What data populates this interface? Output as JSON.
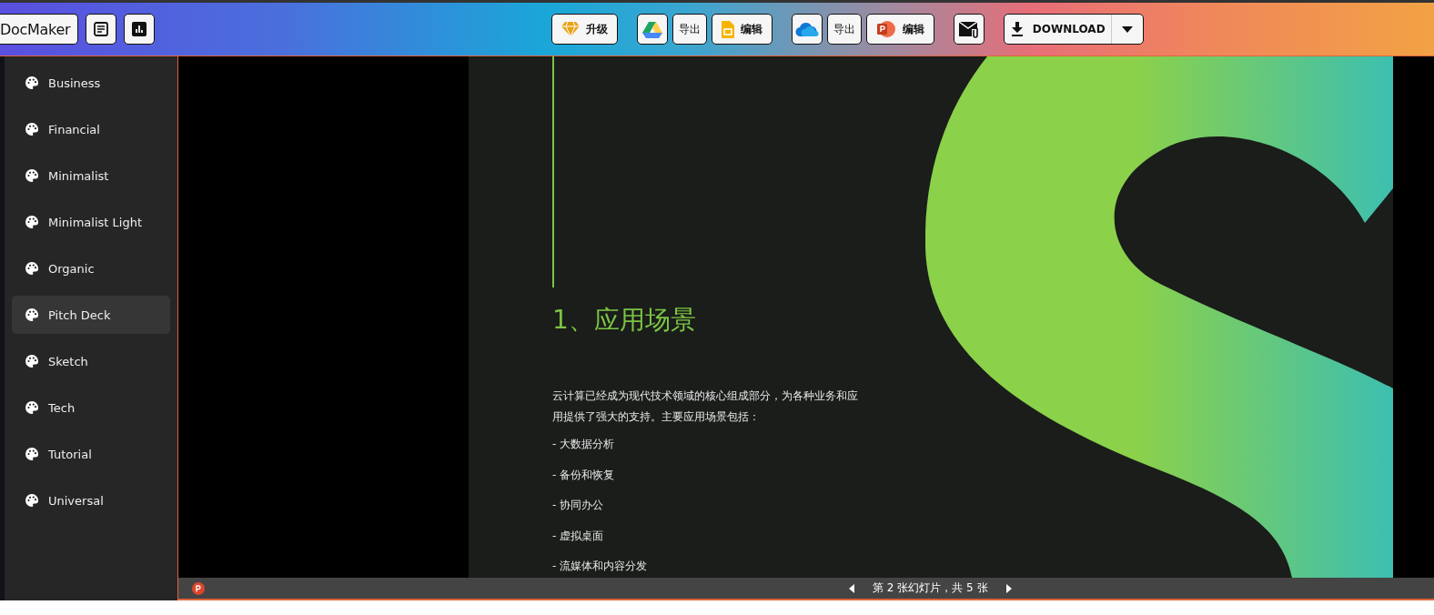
{
  "toolbar": [
    {
      "kind": "brand",
      "label": "DocMaker"
    },
    {
      "kind": "icon"
    },
    {
      "kind": "icon"
    },
    {
      "kind": "gap"
    },
    {
      "kind": "labeled",
      "label": "升级"
    },
    {
      "kind": "gap"
    },
    {
      "kind": "icon"
    },
    {
      "kind": "text",
      "label": "导出"
    },
    {
      "kind": "labeled",
      "label": "编辑"
    },
    {
      "kind": "gap"
    },
    {
      "kind": "icon"
    },
    {
      "kind": "text",
      "label": "导出"
    },
    {
      "kind": "labeled",
      "label": "编辑"
    },
    {
      "kind": "gap"
    },
    {
      "kind": "icon"
    },
    {
      "kind": "gap"
    },
    {
      "kind": "download",
      "label": "DOWNLOAD"
    }
  ],
  "sidebar": {
    "items": [
      {
        "label": "Business",
        "selected": false
      },
      {
        "label": "Financial",
        "selected": false
      },
      {
        "label": "Minimalist",
        "selected": false
      },
      {
        "label": "Minimalist Light",
        "selected": false
      },
      {
        "label": "Organic",
        "selected": false
      },
      {
        "label": "Pitch Deck",
        "selected": true
      },
      {
        "label": "Sketch",
        "selected": false
      },
      {
        "label": "Tech",
        "selected": false
      },
      {
        "label": "Tutorial",
        "selected": false
      },
      {
        "label": "Universal",
        "selected": false
      }
    ]
  },
  "slide": {
    "heading": "1、应用场景",
    "paragraph": "云计算已经成为现代技术领域的核心组成部分，为各种业务和应用提供了强大的支持。主要应用场景包括：",
    "bullets": [
      "- 大数据分析",
      "- 备份和恢复",
      "- 协同办公",
      "- 虚拟桌面",
      "- 流媒体和内容分发"
    ]
  },
  "viewer_bar": {
    "slide_counter": "第 2 张幻灯片，共 5 张"
  }
}
